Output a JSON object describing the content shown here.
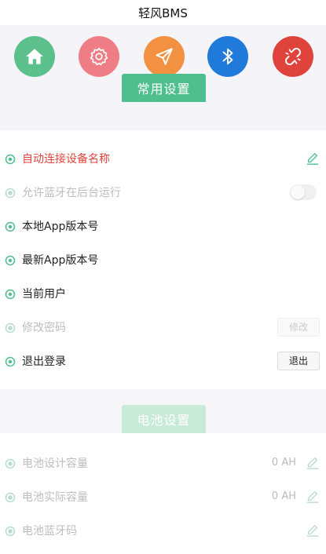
{
  "app": {
    "title": "轻风BMS"
  },
  "toolbar": {
    "icons": [
      "home-icon",
      "settings-icon",
      "send-icon",
      "bluetooth-icon",
      "unlink-icon"
    ],
    "colors": {
      "home": "#5cc08d",
      "settings": "#ef7d85",
      "send": "#f39142",
      "bluetooth": "#1f7ad9",
      "unlink": "#e0433c"
    }
  },
  "common_settings": {
    "tab_label": "常用设置",
    "items": [
      {
        "label": "自动连接设备名称"
      },
      {
        "label": "允许蓝牙在后台运行"
      },
      {
        "label": "本地App版本号"
      },
      {
        "label": "最新App版本号"
      },
      {
        "label": "当前用户"
      },
      {
        "label": "修改密码",
        "button": "修改"
      },
      {
        "label": "退出登录",
        "button": "退出"
      }
    ]
  },
  "battery_settings": {
    "tab_label": "电池设置",
    "items": [
      {
        "label": "电池设计容量",
        "value": "0 AH"
      },
      {
        "label": "电池实际容量",
        "value": "0 AH"
      },
      {
        "label": "电池蓝牙码"
      }
    ]
  },
  "theme": {
    "accent": "#50bf8f",
    "danger": "#e0453b"
  }
}
